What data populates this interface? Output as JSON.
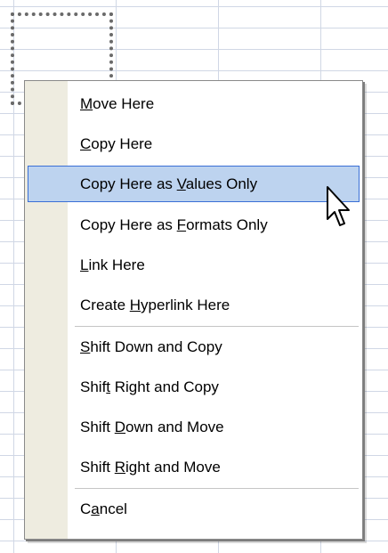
{
  "menu": {
    "items": [
      {
        "pre": "",
        "key": "M",
        "post": "ove Here"
      },
      {
        "pre": "",
        "key": "C",
        "post": "opy Here"
      },
      {
        "pre": "Copy Here as ",
        "key": "V",
        "post": "alues Only"
      },
      {
        "pre": "Copy Here as ",
        "key": "F",
        "post": "ormats Only"
      },
      {
        "pre": "",
        "key": "L",
        "post": "ink Here"
      },
      {
        "pre": "Create ",
        "key": "H",
        "post": "yperlink Here"
      },
      {
        "pre": "",
        "key": "S",
        "post": "hift Down and Copy"
      },
      {
        "pre": "Shif",
        "key": "t",
        "post": " Right and Copy"
      },
      {
        "pre": "Shift ",
        "key": "D",
        "post": "own and Move"
      },
      {
        "pre": "Shift ",
        "key": "R",
        "post": "ight and Move"
      },
      {
        "pre": "C",
        "key": "a",
        "post": "ncel"
      }
    ]
  },
  "colors": {
    "highlight_fill": "#bdd3ef",
    "highlight_border": "#3a6fd6",
    "icon_strip": "#eeece0",
    "grid_lines": "#d0d7e5"
  },
  "icons": {
    "cursor": "arrow-pointer-icon"
  }
}
